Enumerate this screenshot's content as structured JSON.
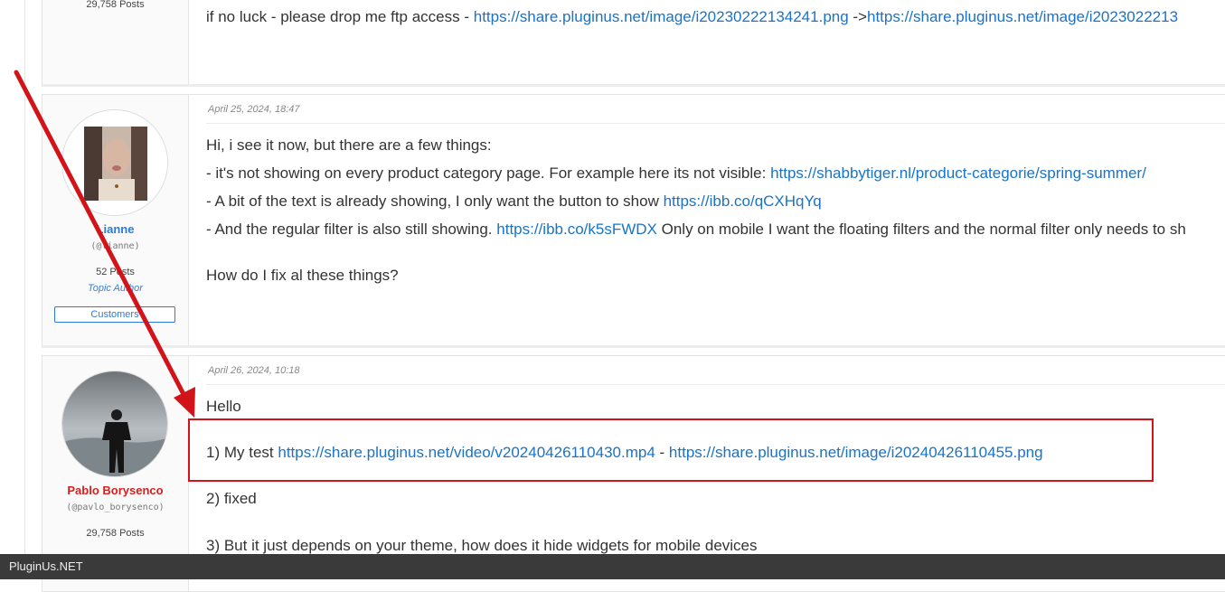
{
  "top_post": {
    "author_posts": "29,758 Posts",
    "text_prefix": "if  no luck  - please drop me ftp access - ",
    "link1": "https://share.pluginus.net/image/i20230222134241.png",
    "separator": " ->",
    "link2": "https://share.pluginus.net/image/i2023022213"
  },
  "post2": {
    "date": "April 25, 2024, 18:47",
    "author_name": "Lianne",
    "author_handle": "(@lianne)",
    "author_posts": "52 Posts",
    "author_role": "Topic Author",
    "author_badge": "Customers",
    "line1": "Hi, i see it now, but there are a few things:",
    "line2_text": "- it's not showing on every product category page. For example here its not visible: ",
    "line2_link": "https://shabbytiger.nl/product-categorie/spring-summer/",
    "line3_text": "- A bit of the text is already showing, I only want the button to show ",
    "line3_link": "https://ibb.co/qCXHqYq",
    "line4_text": "- And the regular filter is also still showing. ",
    "line4_link": "https://ibb.co/k5sFWDX",
    "line4_after": " Only on mobile I want the floating filters and the normal filter only needs to sh",
    "line5": "How do I fix al these things?"
  },
  "post3": {
    "date": "April 26, 2024, 10:18",
    "author_name": "Pablo Borysenco",
    "author_handle": "(@pavlo_borysenco)",
    "author_posts": "29,758 Posts",
    "greeting": "Hello",
    "item1_prefix": "1)  My  test  ",
    "item1_link1": "https://share.pluginus.net/video/v20240426110430.mp4",
    "item1_sep": "  - ",
    "item1_link2": "https://share.pluginus.net/image/i20240426110455.png",
    "item2": "2) fixed",
    "item3": "3) But it just depends on your theme, how does it hide widgets for mobile devices"
  },
  "footer": {
    "brand": "PluginUs.NET"
  },
  "colors": {
    "annotation_red": "#d3131a",
    "link_blue": "#1a73c7",
    "staff_red": "#d42020",
    "customer_blue": "#2b7bd4"
  }
}
